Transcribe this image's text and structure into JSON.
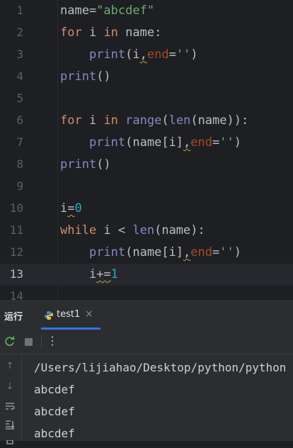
{
  "editor": {
    "current_line": "13",
    "lines": [
      {
        "n": "1",
        "tokens": [
          {
            "t": "name=",
            "c": ""
          },
          {
            "t": "\"abcdef\"",
            "c": "str"
          }
        ]
      },
      {
        "n": "2",
        "tokens": [
          {
            "t": "for",
            "c": "kw"
          },
          {
            "t": " i ",
            "c": ""
          },
          {
            "t": "in",
            "c": "kw"
          },
          {
            "t": " name:",
            "c": ""
          }
        ]
      },
      {
        "n": "3",
        "tokens": [
          {
            "t": "    ",
            "c": ""
          },
          {
            "t": "print",
            "c": "fn"
          },
          {
            "t": "(i",
            "c": ""
          },
          {
            "t": ",",
            "c": "sq"
          },
          {
            "t": "end",
            "c": "param"
          },
          {
            "t": "=",
            "c": ""
          },
          {
            "t": "''",
            "c": "str"
          },
          {
            "t": ")",
            "c": ""
          }
        ]
      },
      {
        "n": "4",
        "tokens": [
          {
            "t": "print",
            "c": "fn"
          },
          {
            "t": "()",
            "c": ""
          }
        ]
      },
      {
        "n": "5",
        "tokens": []
      },
      {
        "n": "6",
        "tokens": [
          {
            "t": "for",
            "c": "kw"
          },
          {
            "t": " i ",
            "c": ""
          },
          {
            "t": "in",
            "c": "kw"
          },
          {
            "t": " ",
            "c": ""
          },
          {
            "t": "range",
            "c": "fn"
          },
          {
            "t": "(",
            "c": ""
          },
          {
            "t": "len",
            "c": "fn"
          },
          {
            "t": "(name)):",
            "c": ""
          }
        ]
      },
      {
        "n": "7",
        "tokens": [
          {
            "t": "    ",
            "c": ""
          },
          {
            "t": "print",
            "c": "fn"
          },
          {
            "t": "(name[i]",
            "c": ""
          },
          {
            "t": ",",
            "c": "sq"
          },
          {
            "t": "end",
            "c": "param"
          },
          {
            "t": "=",
            "c": ""
          },
          {
            "t": "''",
            "c": "str"
          },
          {
            "t": ")",
            "c": ""
          }
        ]
      },
      {
        "n": "8",
        "tokens": [
          {
            "t": "print",
            "c": "fn"
          },
          {
            "t": "()",
            "c": ""
          }
        ]
      },
      {
        "n": "9",
        "tokens": []
      },
      {
        "n": "10",
        "tokens": [
          {
            "t": "i",
            "c": ""
          },
          {
            "t": "=",
            "c": "sq"
          },
          {
            "t": "0",
            "c": "num"
          }
        ]
      },
      {
        "n": "11",
        "tokens": [
          {
            "t": "while",
            "c": "kw"
          },
          {
            "t": " i < ",
            "c": ""
          },
          {
            "t": "len",
            "c": "fn"
          },
          {
            "t": "(name):",
            "c": ""
          }
        ]
      },
      {
        "n": "12",
        "tokens": [
          {
            "t": "    ",
            "c": ""
          },
          {
            "t": "print",
            "c": "fn"
          },
          {
            "t": "(name[i]",
            "c": ""
          },
          {
            "t": ",",
            "c": "sq"
          },
          {
            "t": "end",
            "c": "param"
          },
          {
            "t": "=",
            "c": ""
          },
          {
            "t": "''",
            "c": "str"
          },
          {
            "t": ")",
            "c": ""
          }
        ]
      },
      {
        "n": "13",
        "tokens": [
          {
            "t": "    i",
            "c": ""
          },
          {
            "t": "+=",
            "c": "sq"
          },
          {
            "t": "1",
            "c": "num"
          }
        ]
      },
      {
        "n": "14",
        "tokens": []
      }
    ]
  },
  "run_panel": {
    "title": "运行",
    "tab_label": "test1",
    "tab_close": "×",
    "more_icon": "⋮",
    "console_lines": [
      "/Users/lijiahao/Desktop/python/python",
      "abcdef",
      "abcdef",
      "abcdef"
    ]
  },
  "colors": {
    "editor_bg": "#1e1f22",
    "panel_bg": "#2b2d30",
    "keyword": "#cf8e6d",
    "string": "#6aab73",
    "builtin": "#8888c6",
    "number": "#2aacb8",
    "param": "#aa4926",
    "accent": "#3574f0"
  },
  "icons": {
    "tab": "python-icon",
    "rerun": "rerun-icon",
    "stop": "stop-icon",
    "side": [
      "scroll-up-icon",
      "scroll-down-icon",
      "soft-wrap-icon",
      "scroll-to-end-icon",
      "print-icon"
    ]
  }
}
